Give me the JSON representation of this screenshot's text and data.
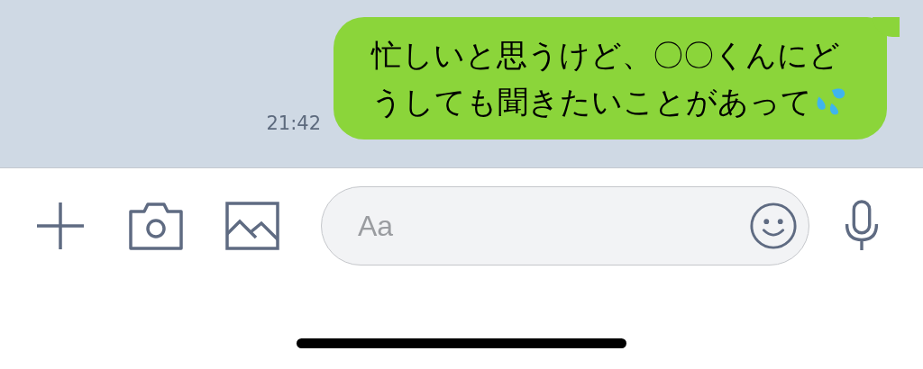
{
  "messages": [
    {
      "text": "忙しいと思うけど、〇〇くんにどうしても聞きたいことがあって",
      "time": "21:42"
    }
  ],
  "input": {
    "placeholder": "Aa"
  }
}
